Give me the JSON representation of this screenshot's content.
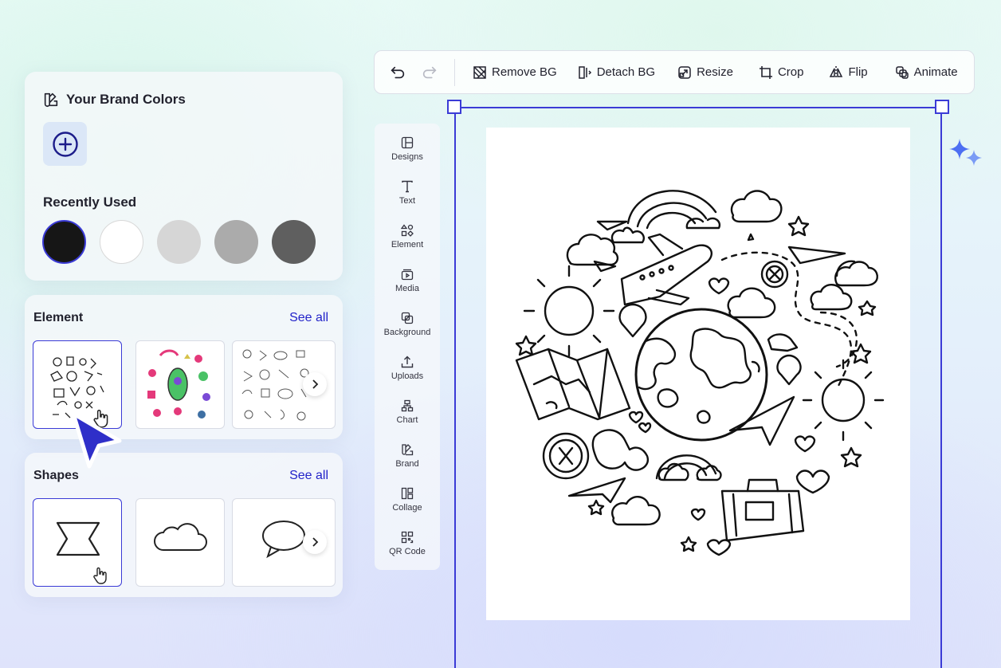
{
  "brand": {
    "title": "Your Brand Colors",
    "recent_title": "Recently Used",
    "swatches": [
      "#161616",
      "#ffffff",
      "#d6d6d6",
      "#ababab",
      "#5f5f5f"
    ]
  },
  "element": {
    "title": "Element",
    "see_all": "See all"
  },
  "shapes": {
    "title": "Shapes",
    "see_all": "See all"
  },
  "toolbar": {
    "remove_bg": "Remove BG",
    "detach_bg": "Detach BG",
    "resize": "Resize",
    "crop": "Crop",
    "flip": "Flip",
    "animate": "Animate"
  },
  "rail": [
    {
      "label": "Designs",
      "icon": "designs-icon"
    },
    {
      "label": "Text",
      "icon": "text-icon"
    },
    {
      "label": "Element",
      "icon": "element-icon"
    },
    {
      "label": "Media",
      "icon": "media-icon"
    },
    {
      "label": "Background",
      "icon": "background-icon"
    },
    {
      "label": "Uploads",
      "icon": "uploads-icon"
    },
    {
      "label": "Chart",
      "icon": "chart-icon"
    },
    {
      "label": "Brand",
      "icon": "brand-icon"
    },
    {
      "label": "Collage",
      "icon": "collage-icon"
    },
    {
      "label": "QR Code",
      "icon": "qr-code-icon"
    }
  ],
  "colors": {
    "accent": "#3b3bd6",
    "link": "#2323c9"
  }
}
